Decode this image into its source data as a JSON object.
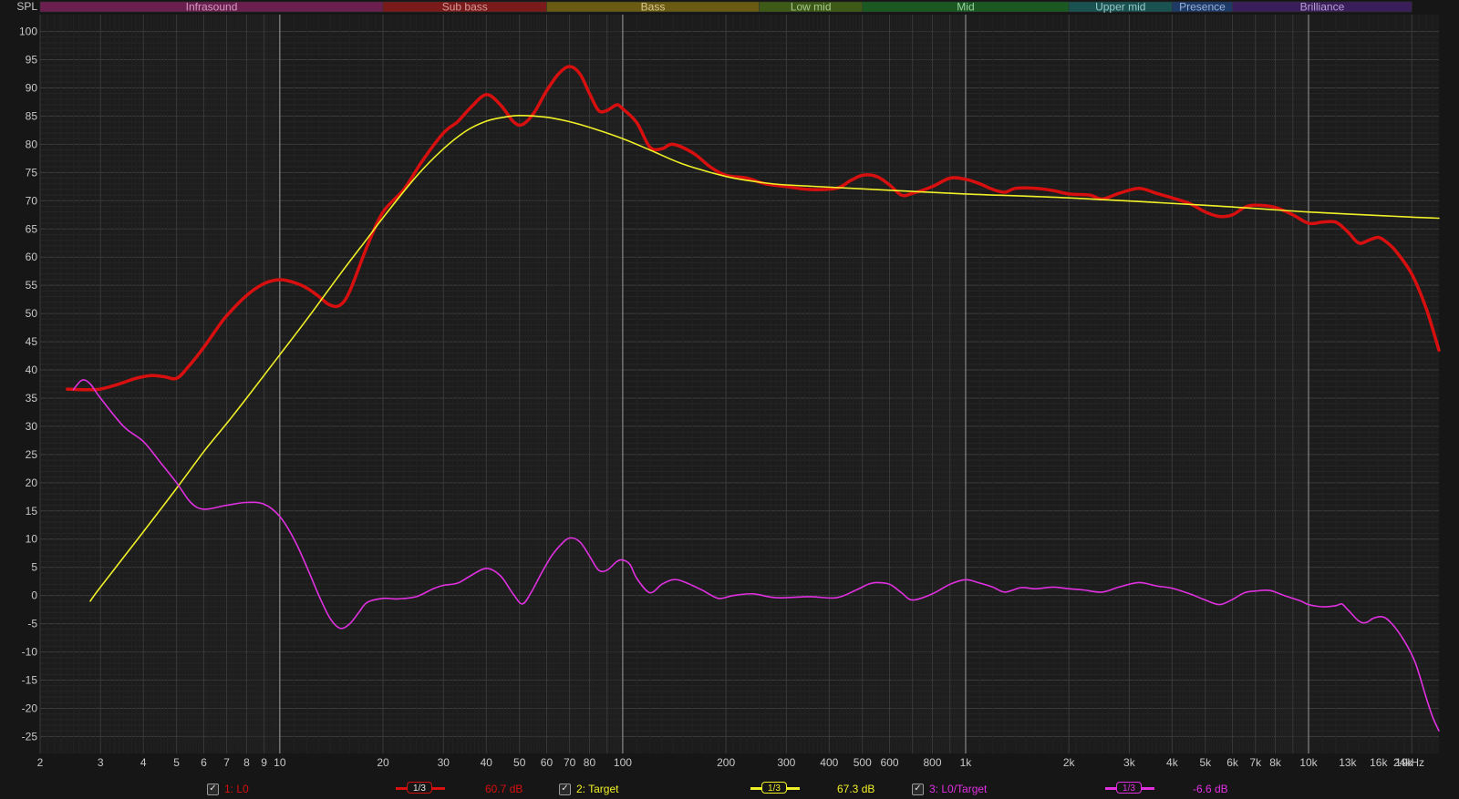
{
  "chart_data": {
    "type": "line",
    "ylabel": "SPL",
    "x_scale": "log",
    "x_range_hz": [
      2,
      24000
    ],
    "ylim": [
      -28,
      103
    ],
    "yticks": [
      100,
      95,
      90,
      85,
      80,
      75,
      70,
      65,
      60,
      55,
      50,
      45,
      40,
      35,
      30,
      25,
      20,
      15,
      10,
      5,
      0,
      -5,
      -10,
      -15,
      -20,
      -25
    ],
    "xticks": [
      {
        "hz": 2,
        "label": "2"
      },
      {
        "hz": 3,
        "label": "3"
      },
      {
        "hz": 4,
        "label": "4"
      },
      {
        "hz": 5,
        "label": "5"
      },
      {
        "hz": 6,
        "label": "6"
      },
      {
        "hz": 7,
        "label": "7"
      },
      {
        "hz": 8,
        "label": "8"
      },
      {
        "hz": 9,
        "label": "9"
      },
      {
        "hz": 10,
        "label": "10"
      },
      {
        "hz": 20,
        "label": "20"
      },
      {
        "hz": 30,
        "label": "30"
      },
      {
        "hz": 40,
        "label": "40"
      },
      {
        "hz": 50,
        "label": "50"
      },
      {
        "hz": 60,
        "label": "60"
      },
      {
        "hz": 70,
        "label": "70"
      },
      {
        "hz": 80,
        "label": "80"
      },
      {
        "hz": 100,
        "label": "100"
      },
      {
        "hz": 200,
        "label": "200"
      },
      {
        "hz": 300,
        "label": "300"
      },
      {
        "hz": 400,
        "label": "400"
      },
      {
        "hz": 500,
        "label": "500"
      },
      {
        "hz": 600,
        "label": "600"
      },
      {
        "hz": 800,
        "label": "800"
      },
      {
        "hz": 1000,
        "label": "1k"
      },
      {
        "hz": 2000,
        "label": "2k"
      },
      {
        "hz": 3000,
        "label": "3k"
      },
      {
        "hz": 4000,
        "label": "4k"
      },
      {
        "hz": 5000,
        "label": "5k"
      },
      {
        "hz": 6000,
        "label": "6k"
      },
      {
        "hz": 7000,
        "label": "7k"
      },
      {
        "hz": 8000,
        "label": "8k"
      },
      {
        "hz": 10000,
        "label": "10k"
      },
      {
        "hz": 13000,
        "label": "13k",
        "dim": true
      },
      {
        "hz": 16000,
        "label": "16k",
        "dim": true
      },
      {
        "hz": 19000,
        "label": "19k",
        "dim": true
      },
      {
        "hz": 24000,
        "label": "24kHz"
      }
    ],
    "bands": [
      {
        "name": "Infrasound",
        "from_hz": 2,
        "to_hz": 20,
        "fill": "#6b1f4f",
        "text": "#d39ac0"
      },
      {
        "name": "Sub bass",
        "from_hz": 20,
        "to_hz": 60,
        "fill": "#7a1a1a",
        "text": "#d89a9a"
      },
      {
        "name": "Bass",
        "from_hz": 60,
        "to_hz": 250,
        "fill": "#6b5a12",
        "text": "#d8c890"
      },
      {
        "name": "Low mid",
        "from_hz": 250,
        "to_hz": 500,
        "fill": "#3d5a16",
        "text": "#a8c890"
      },
      {
        "name": "Mid",
        "from_hz": 500,
        "to_hz": 2000,
        "fill": "#1a5a22",
        "text": "#98d0a0"
      },
      {
        "name": "Upper mid",
        "from_hz": 2000,
        "to_hz": 4000,
        "fill": "#1a5252",
        "text": "#98c8c8"
      },
      {
        "name": "Presence",
        "from_hz": 4000,
        "to_hz": 6000,
        "fill": "#1e3a66",
        "text": "#9ab0d8"
      },
      {
        "name": "Brilliance",
        "from_hz": 6000,
        "to_hz": 20000,
        "fill": "#3a1e5a",
        "text": "#b8a0d8"
      }
    ],
    "series": [
      {
        "name": "1: L0",
        "color": "#d80f0f",
        "width": 3.5,
        "smoothing": "1/3",
        "value": "60.7 dB",
        "points": [
          [
            2.4,
            36.6
          ],
          [
            2.7,
            36.5
          ],
          [
            3,
            36.6
          ],
          [
            3.4,
            37.5
          ],
          [
            3.8,
            38.5
          ],
          [
            4.2,
            39
          ],
          [
            4.6,
            38.8
          ],
          [
            5,
            38.5
          ],
          [
            5.4,
            40.5
          ],
          [
            6,
            44
          ],
          [
            6.5,
            47
          ],
          [
            7,
            49.6
          ],
          [
            8,
            53.2
          ],
          [
            9,
            55.3
          ],
          [
            10,
            56
          ],
          [
            11,
            55.5
          ],
          [
            12,
            54.5
          ],
          [
            13,
            53
          ],
          [
            14,
            51.5
          ],
          [
            15,
            51.5
          ],
          [
            16,
            54
          ],
          [
            18,
            62
          ],
          [
            20,
            68
          ],
          [
            23,
            72
          ],
          [
            26,
            77
          ],
          [
            30,
            82
          ],
          [
            33,
            84
          ],
          [
            36,
            86.5
          ],
          [
            40,
            88.8
          ],
          [
            44,
            87
          ],
          [
            48,
            84
          ],
          [
            51,
            83.5
          ],
          [
            55,
            85.5
          ],
          [
            60,
            89.5
          ],
          [
            65,
            92.5
          ],
          [
            70,
            93.8
          ],
          [
            75,
            92.5
          ],
          [
            80,
            89
          ],
          [
            85,
            86
          ],
          [
            90,
            86
          ],
          [
            96,
            87
          ],
          [
            100,
            86.3
          ],
          [
            110,
            83.8
          ],
          [
            120,
            79.5
          ],
          [
            130,
            79.2
          ],
          [
            140,
            80
          ],
          [
            160,
            78.5
          ],
          [
            180,
            76
          ],
          [
            200,
            74.5
          ],
          [
            230,
            74
          ],
          [
            260,
            73
          ],
          [
            300,
            72.5
          ],
          [
            350,
            72
          ],
          [
            420,
            72.2
          ],
          [
            460,
            73.5
          ],
          [
            500,
            74.5
          ],
          [
            550,
            74.3
          ],
          [
            600,
            72.8
          ],
          [
            650,
            71
          ],
          [
            700,
            71.3
          ],
          [
            800,
            72.5
          ],
          [
            900,
            74
          ],
          [
            1000,
            73.8
          ],
          [
            1100,
            73
          ],
          [
            1200,
            72
          ],
          [
            1300,
            71.5
          ],
          [
            1400,
            72.2
          ],
          [
            1600,
            72.2
          ],
          [
            1800,
            71.8
          ],
          [
            2000,
            71.2
          ],
          [
            2300,
            71
          ],
          [
            2500,
            70.3
          ],
          [
            2800,
            71.3
          ],
          [
            3200,
            72.2
          ],
          [
            3600,
            71.3
          ],
          [
            4000,
            70.5
          ],
          [
            4500,
            69.5
          ],
          [
            5000,
            68
          ],
          [
            5500,
            67.2
          ],
          [
            6000,
            67.5
          ],
          [
            6500,
            68.8
          ],
          [
            7000,
            69.2
          ],
          [
            8000,
            68.8
          ],
          [
            9000,
            67.5
          ],
          [
            10000,
            66
          ],
          [
            11000,
            66.2
          ],
          [
            12000,
            66.2
          ],
          [
            13000,
            64.5
          ],
          [
            14000,
            62.5
          ],
          [
            15000,
            63
          ],
          [
            16000,
            63.5
          ],
          [
            17000,
            62.5
          ],
          [
            18000,
            61
          ],
          [
            20000,
            57
          ],
          [
            22000,
            51
          ],
          [
            24000,
            43.5
          ]
        ]
      },
      {
        "name": "2: Target",
        "color": "#f0f028",
        "width": 1.6,
        "smoothing": "1/3",
        "value": "67.3 dB",
        "points": [
          [
            2.8,
            -1
          ],
          [
            3,
            1.5
          ],
          [
            4,
            11.3
          ],
          [
            5,
            19
          ],
          [
            6,
            25.5
          ],
          [
            7,
            30.5
          ],
          [
            8,
            35
          ],
          [
            10,
            42.7
          ],
          [
            12,
            49
          ],
          [
            15,
            57
          ],
          [
            18,
            63.3
          ],
          [
            20,
            67
          ],
          [
            25,
            74.3
          ],
          [
            30,
            79.2
          ],
          [
            35,
            82.4
          ],
          [
            40,
            84.1
          ],
          [
            45,
            84.8
          ],
          [
            50,
            85.1
          ],
          [
            60,
            84.8
          ],
          [
            70,
            84
          ],
          [
            80,
            83
          ],
          [
            100,
            81
          ],
          [
            120,
            79
          ],
          [
            150,
            76.5
          ],
          [
            200,
            74.3
          ],
          [
            250,
            73.3
          ],
          [
            300,
            72.8
          ],
          [
            500,
            72.1
          ],
          [
            1000,
            71.2
          ],
          [
            2000,
            70.5
          ],
          [
            5000,
            69.2
          ],
          [
            10000,
            68
          ],
          [
            20000,
            67.1
          ],
          [
            24000,
            66.9
          ]
        ]
      },
      {
        "name": "3: L0/Target",
        "color": "#e030e0",
        "width": 1.6,
        "smoothing": "1/3",
        "value": "-6.6 dB",
        "points": [
          [
            2.5,
            36.5
          ],
          [
            2.65,
            38.2
          ],
          [
            2.8,
            37.5
          ],
          [
            3,
            35
          ],
          [
            3.5,
            30
          ],
          [
            4,
            27.3
          ],
          [
            4.5,
            23.5
          ],
          [
            5,
            20
          ],
          [
            5.5,
            16.5
          ],
          [
            6,
            15.3
          ],
          [
            7,
            16
          ],
          [
            8,
            16.5
          ],
          [
            9,
            16.2
          ],
          [
            10,
            14
          ],
          [
            11,
            10
          ],
          [
            12,
            5
          ],
          [
            13,
            0
          ],
          [
            14,
            -4
          ],
          [
            15,
            -5.8
          ],
          [
            16,
            -5
          ],
          [
            17,
            -3
          ],
          [
            18,
            -1.2
          ],
          [
            20,
            -0.5
          ],
          [
            22,
            -0.6
          ],
          [
            25,
            -0.2
          ],
          [
            28,
            1.2
          ],
          [
            30,
            1.8
          ],
          [
            33,
            2.2
          ],
          [
            36,
            3.5
          ],
          [
            40,
            4.8
          ],
          [
            44,
            3.5
          ],
          [
            48,
            0.2
          ],
          [
            51,
            -1.5
          ],
          [
            54,
            0.5
          ],
          [
            58,
            4
          ],
          [
            62,
            7
          ],
          [
            66,
            9
          ],
          [
            70,
            10.2
          ],
          [
            75,
            9.5
          ],
          [
            80,
            7
          ],
          [
            85,
            4.5
          ],
          [
            90,
            4.5
          ],
          [
            96,
            6
          ],
          [
            100,
            6.3
          ],
          [
            105,
            5.5
          ],
          [
            110,
            3
          ],
          [
            120,
            0.5
          ],
          [
            130,
            2
          ],
          [
            140,
            2.8
          ],
          [
            150,
            2.5
          ],
          [
            170,
            1
          ],
          [
            190,
            -0.5
          ],
          [
            210,
            0
          ],
          [
            240,
            0.3
          ],
          [
            280,
            -0.4
          ],
          [
            350,
            -0.2
          ],
          [
            420,
            -0.4
          ],
          [
            480,
            1
          ],
          [
            520,
            2
          ],
          [
            550,
            2.3
          ],
          [
            600,
            2
          ],
          [
            650,
            0.5
          ],
          [
            700,
            -0.8
          ],
          [
            800,
            0.3
          ],
          [
            900,
            2
          ],
          [
            1000,
            2.8
          ],
          [
            1100,
            2.2
          ],
          [
            1200,
            1.5
          ],
          [
            1300,
            0.6
          ],
          [
            1450,
            1.4
          ],
          [
            1600,
            1.2
          ],
          [
            1800,
            1.5
          ],
          [
            2000,
            1.2
          ],
          [
            2200,
            1
          ],
          [
            2500,
            0.6
          ],
          [
            2800,
            1.5
          ],
          [
            3200,
            2.3
          ],
          [
            3600,
            1.7
          ],
          [
            4000,
            1.3
          ],
          [
            4500,
            0.3
          ],
          [
            5000,
            -0.8
          ],
          [
            5500,
            -1.6
          ],
          [
            6000,
            -0.7
          ],
          [
            6500,
            0.5
          ],
          [
            7000,
            0.8
          ],
          [
            7700,
            0.9
          ],
          [
            8500,
            0
          ],
          [
            9500,
            -1
          ],
          [
            10000,
            -1.6
          ],
          [
            11000,
            -2
          ],
          [
            12000,
            -1.8
          ],
          [
            12500,
            -1.5
          ],
          [
            13000,
            -2.5
          ],
          [
            14000,
            -4.5
          ],
          [
            14700,
            -4.8
          ],
          [
            15500,
            -4
          ],
          [
            16500,
            -3.8
          ],
          [
            17500,
            -5
          ],
          [
            19000,
            -8
          ],
          [
            20500,
            -12
          ],
          [
            22000,
            -18
          ],
          [
            23000,
            -21.5
          ],
          [
            24000,
            -24
          ]
        ]
      }
    ]
  },
  "legend": [
    {
      "checkbox": "✓",
      "label": "1: L0",
      "smoothing": "1/3",
      "value": "60.7 dB",
      "color": "#d80f0f"
    },
    {
      "checkbox": "✓",
      "label": "2: Target",
      "smoothing": "1/3",
      "value": "67.3 dB",
      "color": "#f0f028"
    },
    {
      "checkbox": "✓",
      "label": "3: L0/Target",
      "smoothing": "1/3",
      "value": "-6.6 dB",
      "color": "#e030e0"
    }
  ]
}
